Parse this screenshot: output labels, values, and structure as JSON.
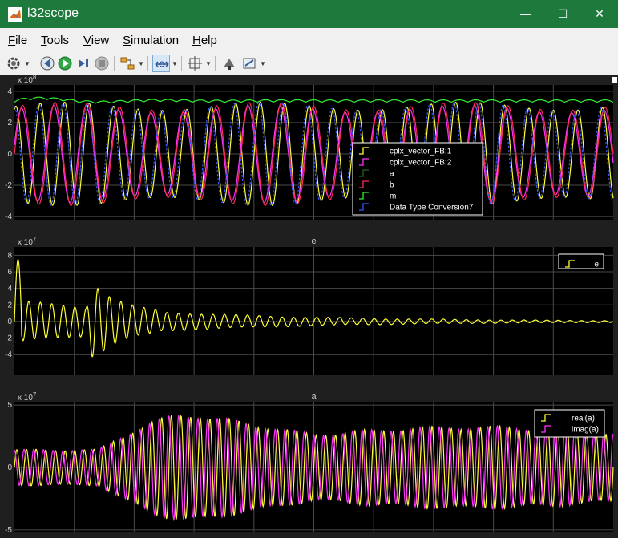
{
  "window": {
    "title": "l32scope",
    "minimize": "—",
    "maximize": "☐",
    "close": "✕"
  },
  "menu": {
    "items": [
      {
        "name": "File",
        "mnemonic": "F",
        "rest": "ile"
      },
      {
        "name": "Tools",
        "mnemonic": "T",
        "rest": "ools"
      },
      {
        "name": "View",
        "mnemonic": "V",
        "rest": "iew"
      },
      {
        "name": "Simulation",
        "mnemonic": "S",
        "rest": "imulation"
      },
      {
        "name": "Help",
        "mnemonic": "H",
        "rest": "elp"
      }
    ]
  },
  "toolbar": {
    "icons": [
      "gear-icon",
      "step-back-icon",
      "run-icon",
      "step-forward-icon",
      "stop-icon",
      "signal-select-icon",
      "zoom-x-icon",
      "fit-view-icon",
      "highlight-icon",
      "style-icon"
    ]
  },
  "colors": {
    "yellow": "#ffff33",
    "magenta": "#ff33ff",
    "cyan": "#00ffff",
    "red": "#ff2a5a",
    "green": "#33ee33",
    "blue": "#3355ff",
    "white": "#ffffff",
    "dark_green": "#226622",
    "grid": "#4a4a4a",
    "axes_bg": "#000000"
  },
  "chart_data": [
    {
      "type": "line",
      "title": "",
      "exponent_label": "x 10^8",
      "exp_base": "x 10",
      "exp_power": "8",
      "ylim": [
        -4.2,
        4.4
      ],
      "yticks": [
        4,
        2,
        0,
        -2,
        -4
      ],
      "legend_placement": "right-middle",
      "series": [
        {
          "name": "cplx_vector_FB:1",
          "color": "#ffff33",
          "kind": "sine",
          "amplitude": 3.3,
          "cycles": 24.5,
          "phase": 1.2,
          "offset": 0
        },
        {
          "name": "cplx_vector_FB:2",
          "color": "#ff33ff",
          "kind": "sine",
          "amplitude": 3.1,
          "cycles": 18.5,
          "phase": 0.2,
          "offset": 0
        },
        {
          "name": "a",
          "color": "#226622",
          "kind": "hidden"
        },
        {
          "name": "b",
          "color": "#ff2a5a",
          "kind": "sine",
          "amplitude": 3.3,
          "cycles": 18.5,
          "phase": 0.0,
          "offset": 0
        },
        {
          "name": "m",
          "color": "#33ee33",
          "kind": "envelope",
          "level": 3.3,
          "ripple": 0.15,
          "cycles": 18.5
        },
        {
          "name": "Data Type Conversion7",
          "color": "#3355ff",
          "kind": "sine",
          "amplitude": 3.3,
          "cycles": 24.5,
          "phase": 1.6,
          "offset": 0,
          "dashed": true
        }
      ]
    },
    {
      "type": "line",
      "title": "e",
      "exponent_label": "x 10^7",
      "exp_base": "x 10",
      "exp_power": "7",
      "ylim": [
        -6.5,
        9.0
      ],
      "yticks": [
        8,
        6,
        4,
        2,
        0,
        -2,
        -4
      ],
      "legend_placement": "top-right",
      "series": [
        {
          "name": "e",
          "color": "#ffff33",
          "kind": "damped",
          "amplitude": 2.5,
          "cycles": 52,
          "decay": 3.2,
          "spike": 7.5,
          "burst_at": 0.12,
          "burst_amp": 4.0
        }
      ]
    },
    {
      "type": "line",
      "title": "a",
      "exponent_label": "x 10^7",
      "exp_base": "x 10",
      "exp_power": "7",
      "ylim": [
        -5.2,
        5.2
      ],
      "yticks": [
        5,
        0,
        -5
      ],
      "legend_placement": "top-right",
      "series": [
        {
          "name": "real(a)",
          "color": "#ffff33",
          "kind": "modulated",
          "cycles": 62,
          "phase": 0.0
        },
        {
          "name": "imag(a)",
          "color": "#ff33ff",
          "kind": "modulated",
          "cycles": 62,
          "phase": 1.57
        }
      ]
    }
  ]
}
